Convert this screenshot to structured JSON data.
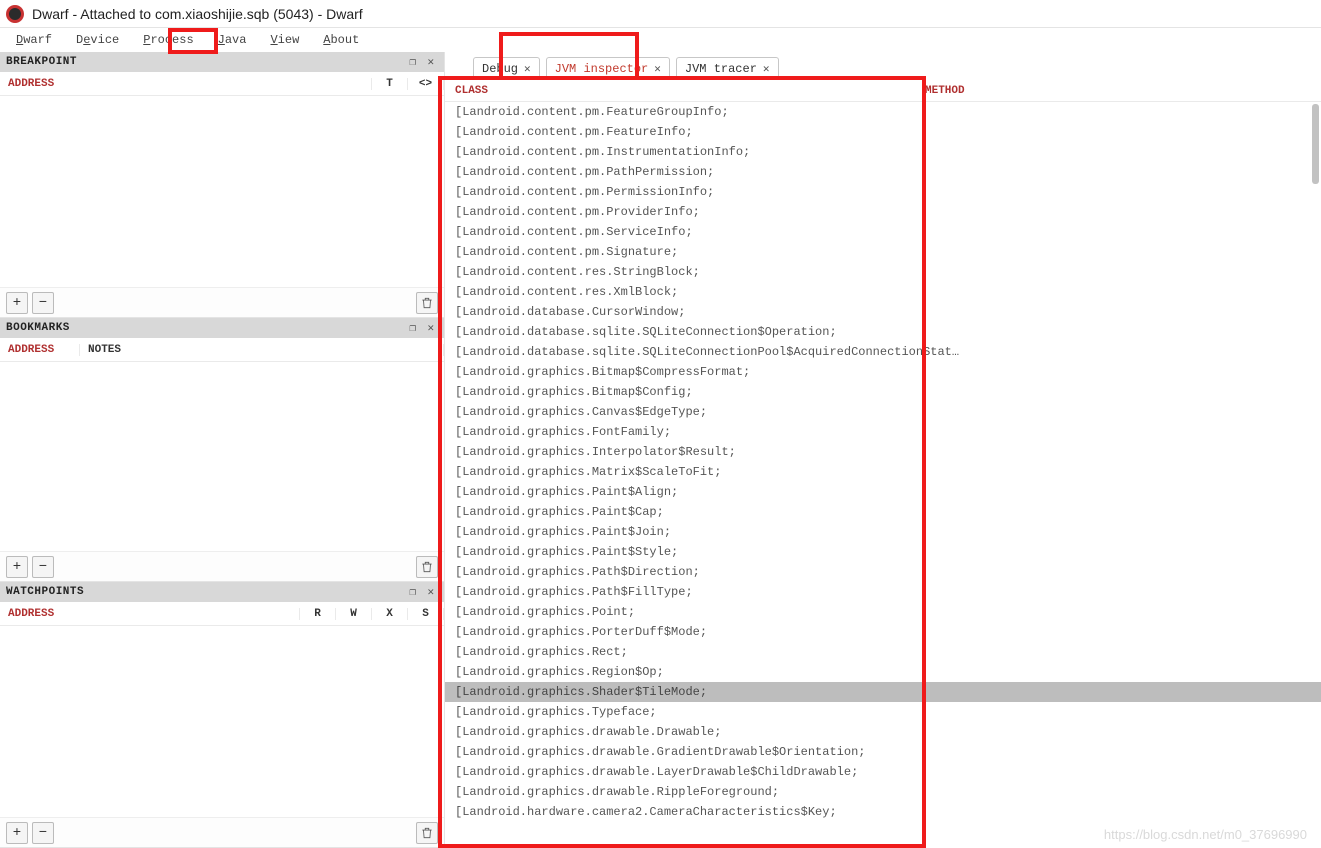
{
  "window": {
    "title": "Dwarf - Attached to com.xiaoshijie.sqb (5043) - Dwarf"
  },
  "menubar": {
    "dwarf": {
      "label": "Dwarf",
      "ukey": "D"
    },
    "device": {
      "label": "Device",
      "ukey": "e"
    },
    "process": {
      "label": "Process",
      "ukey": "P"
    },
    "java": {
      "label": "Java",
      "ukey": "J"
    },
    "view": {
      "label": "View",
      "ukey": "V"
    },
    "about": {
      "label": "About",
      "ukey": "A"
    }
  },
  "panels": {
    "breakpoint": {
      "title": "BREAKPOINT",
      "cols": {
        "address": "ADDRESS",
        "t": "T",
        "code": "<>"
      }
    },
    "bookmarks": {
      "title": "BOOKMARKS",
      "cols": {
        "address": "ADDRESS",
        "notes": "NOTES"
      }
    },
    "watchpoints": {
      "title": "WATCHPOINTS",
      "cols": {
        "address": "ADDRESS",
        "r": "R",
        "w": "W",
        "x": "X",
        "s": "S"
      }
    }
  },
  "buttons": {
    "plus": "+",
    "minus": "−"
  },
  "tabs": {
    "debug": {
      "label": "Debug"
    },
    "jvm_inspector": {
      "label": "JVM inspector"
    },
    "jvm_tracer": {
      "label": "JVM tracer"
    }
  },
  "class_table": {
    "headers": {
      "class": "CLASS",
      "method": "METHOD"
    },
    "rows": [
      "[Landroid.content.pm.FeatureGroupInfo;",
      "[Landroid.content.pm.FeatureInfo;",
      "[Landroid.content.pm.InstrumentationInfo;",
      "[Landroid.content.pm.PathPermission;",
      "[Landroid.content.pm.PermissionInfo;",
      "[Landroid.content.pm.ProviderInfo;",
      "[Landroid.content.pm.ServiceInfo;",
      "[Landroid.content.pm.Signature;",
      "[Landroid.content.res.StringBlock;",
      "[Landroid.content.res.XmlBlock;",
      "[Landroid.database.CursorWindow;",
      "[Landroid.database.sqlite.SQLiteConnection$Operation;",
      "[Landroid.database.sqlite.SQLiteConnectionPool$AcquiredConnectionStat…",
      "[Landroid.graphics.Bitmap$CompressFormat;",
      "[Landroid.graphics.Bitmap$Config;",
      "[Landroid.graphics.Canvas$EdgeType;",
      "[Landroid.graphics.FontFamily;",
      "[Landroid.graphics.Interpolator$Result;",
      "[Landroid.graphics.Matrix$ScaleToFit;",
      "[Landroid.graphics.Paint$Align;",
      "[Landroid.graphics.Paint$Cap;",
      "[Landroid.graphics.Paint$Join;",
      "[Landroid.graphics.Paint$Style;",
      "[Landroid.graphics.Path$Direction;",
      "[Landroid.graphics.Path$FillType;",
      "[Landroid.graphics.Point;",
      "[Landroid.graphics.PorterDuff$Mode;",
      "[Landroid.graphics.Rect;",
      "[Landroid.graphics.Region$Op;",
      "[Landroid.graphics.Shader$TileMode;",
      "[Landroid.graphics.Typeface;",
      "[Landroid.graphics.drawable.Drawable;",
      "[Landroid.graphics.drawable.GradientDrawable$Orientation;",
      "[Landroid.graphics.drawable.LayerDrawable$ChildDrawable;",
      "[Landroid.graphics.drawable.RippleForeground;",
      "[Landroid.hardware.camera2.CameraCharacteristics$Key;"
    ],
    "selected_index": 29
  },
  "watermark": "https://blog.csdn.net/m0_37696990"
}
